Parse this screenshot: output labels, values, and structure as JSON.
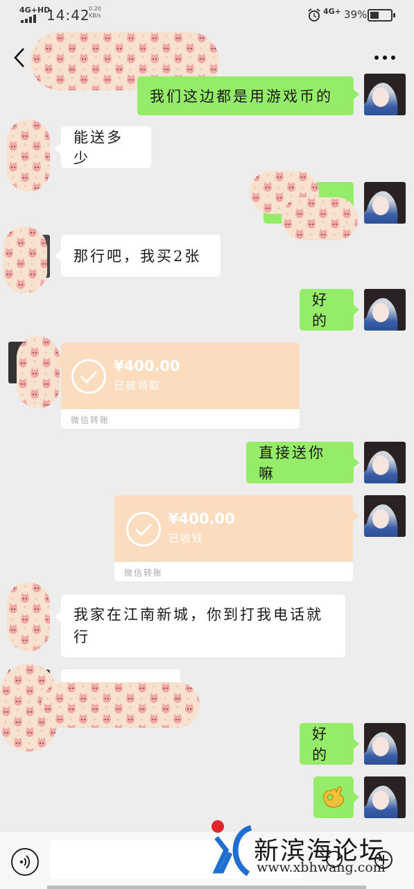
{
  "status_bar": {
    "network": "4G+HD",
    "time": "14:42",
    "speed_value": "0.20",
    "speed_unit": "KB/s",
    "network_right": "4G+",
    "battery": "39%"
  },
  "header": {
    "back_icon": "back-chevron-icon",
    "more_icon": "more-dots-icon"
  },
  "messages": {
    "m1": {
      "text": "我们这边都是用游戏币的"
    },
    "m2": {
      "text": "能送多少"
    },
    "m3": {
      "text": "那行吧，我买2张"
    },
    "m4": {
      "text": "好的"
    },
    "m5": {
      "amount": "¥400.00",
      "status": "已被领取",
      "footer": "微信转账"
    },
    "m6": {
      "text": "直接送你嘛"
    },
    "m7": {
      "amount": "¥400.00",
      "status": "已收钱",
      "footer": "微信转账"
    },
    "m8": {
      "line1": "我家在江南新城，你到打我电话就",
      "line2": "行"
    },
    "m9": {
      "text": "好的"
    },
    "m10": {
      "icon": "ok-hand-emoji-icon"
    }
  },
  "input_bar": {
    "voice_icon": "voice-icon"
  },
  "watermark": {
    "title": "新滨海论坛",
    "url": "www.xbhwang.com"
  },
  "colors": {
    "background": "#ededed",
    "my_bubble": "#95ec69",
    "their_bubble": "#ffffff",
    "transfer_card": "#fbdcbf"
  }
}
